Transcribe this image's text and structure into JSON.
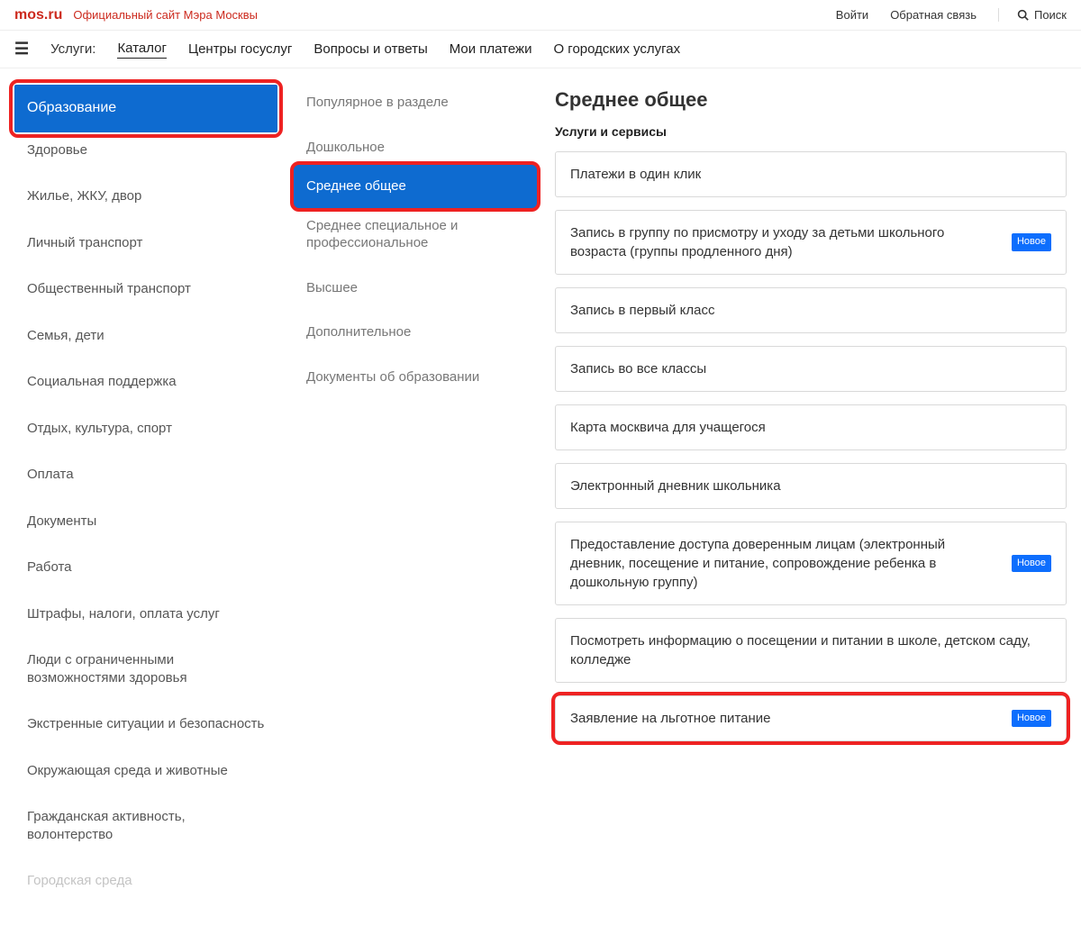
{
  "topbar": {
    "logo": "mos.ru",
    "slogan": "Официальный сайт Мэра Москвы",
    "login": "Войти",
    "feedback": "Обратная связь",
    "search": "Поиск"
  },
  "nav": {
    "title": "Услуги:",
    "items": [
      "Каталог",
      "Центры госуслуг",
      "Вопросы и ответы",
      "Мои платежи",
      "О городских услугах"
    ],
    "active_index": 0
  },
  "categories": [
    "Образование",
    "Здоровье",
    "Жилье, ЖКУ, двор",
    "Личный транспорт",
    "Общественный транспорт",
    "Семья, дети",
    "Социальная поддержка",
    "Отдых, культура, спорт",
    "Оплата",
    "Документы",
    "Работа",
    "Штрафы, налоги, оплата услуг",
    "Люди с ограниченными возможностями здоровья",
    "Экстренные ситуации и безопасность",
    "Окружающая среда и животные",
    "Гражданская активность, волонтерство",
    "Городская среда"
  ],
  "categories_active_index": 0,
  "subcategories": [
    "Популярное в разделе",
    "Дошкольное",
    "Среднее общее",
    "Среднее специальное и профессиональное",
    "Высшее",
    "Дополнительное",
    "Документы об образовании"
  ],
  "subcategories_active_index": 2,
  "right": {
    "title": "Среднее общее",
    "subtitle": "Услуги и сервисы",
    "badge_label": "Новое",
    "services": [
      {
        "label": "Платежи в один клик",
        "badge": false
      },
      {
        "label": "Запись в группу по присмотру и уходу за детьми школьного возраста (группы продленного дня)",
        "badge": true
      },
      {
        "label": "Запись в первый класс",
        "badge": false
      },
      {
        "label": "Запись во все классы",
        "badge": false
      },
      {
        "label": "Карта москвича для учащегося",
        "badge": false
      },
      {
        "label": "Электронный дневник школьника",
        "badge": false
      },
      {
        "label": "Предоставление доступа доверенным лицам (электронный дневник, посещение и питание, сопровождение ребенка в дошкольную группу)",
        "badge": true
      },
      {
        "label": "Посмотреть информацию о посещении и питании в школе, детском саду, колледже",
        "badge": false
      },
      {
        "label": "Заявление на льготное питание",
        "badge": true
      }
    ]
  },
  "highlights": {
    "category_index": 0,
    "subcategory_index": 2,
    "service_index": 8
  }
}
